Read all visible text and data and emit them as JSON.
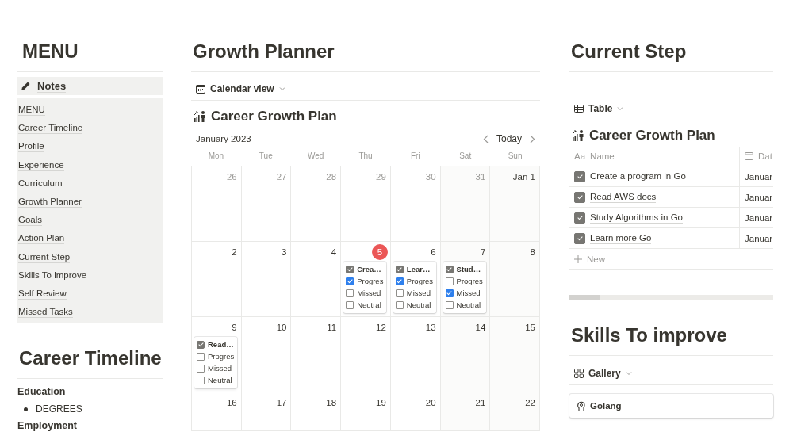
{
  "menu": {
    "title": "MENU",
    "callout": "Notes",
    "links": [
      "MENU",
      "Career Timeline",
      "Profile",
      "Experience",
      "Curriculum",
      "Growth Planner",
      "Goals",
      "Action Plan",
      "Current Step",
      "Skills To improve",
      "Self Review",
      "Missed Tasks"
    ]
  },
  "career_timeline": {
    "title": "Career Timeline",
    "sections": [
      {
        "heading": "Education",
        "bullets": [
          "DEGREES"
        ]
      },
      {
        "heading": "Employment"
      }
    ]
  },
  "growth_planner": {
    "title": "Growth Planner",
    "view": "Calendar view",
    "database_title": "Career Growth Plan",
    "month": "January 2023",
    "today_button": "Today",
    "weekdays": [
      "Mon",
      "Tue",
      "Wed",
      "Thu",
      "Fri",
      "Sat",
      "Sun"
    ],
    "weeks": [
      [
        {
          "label": "26",
          "current_month": false,
          "today": false
        },
        {
          "label": "27",
          "current_month": false,
          "today": false
        },
        {
          "label": "28",
          "current_month": false,
          "today": false
        },
        {
          "label": "29",
          "current_month": false,
          "today": false
        },
        {
          "label": "30",
          "current_month": false,
          "today": false
        },
        {
          "label": "31",
          "current_month": false,
          "today": false
        },
        {
          "label": "Jan 1",
          "current_month": true,
          "today": false
        }
      ],
      [
        {
          "label": "2",
          "current_month": true,
          "today": false
        },
        {
          "label": "3",
          "current_month": true,
          "today": false
        },
        {
          "label": "4",
          "current_month": true,
          "today": false
        },
        {
          "label": "5",
          "current_month": true,
          "today": true,
          "events": [
            {
              "title": "Crea…",
              "checked": true,
              "options": [
                {
                  "label": "Progres",
                  "checked": true
                },
                {
                  "label": "Missed",
                  "checked": false
                },
                {
                  "label": "Neutral",
                  "checked": false
                }
              ]
            }
          ]
        },
        {
          "label": "6",
          "current_month": true,
          "today": false,
          "events": [
            {
              "title": "Lear…",
              "checked": true,
              "options": [
                {
                  "label": "Progres",
                  "checked": true
                },
                {
                  "label": "Missed",
                  "checked": false
                },
                {
                  "label": "Neutral",
                  "checked": false
                }
              ]
            }
          ]
        },
        {
          "label": "7",
          "current_month": true,
          "today": false,
          "events": [
            {
              "title": "Stud…",
              "checked": true,
              "options": [
                {
                  "label": "Progres",
                  "checked": false
                },
                {
                  "label": "Missed",
                  "checked": true
                },
                {
                  "label": "Neutral",
                  "checked": false
                }
              ]
            }
          ]
        },
        {
          "label": "8",
          "current_month": true,
          "today": false
        }
      ],
      [
        {
          "label": "9",
          "current_month": true,
          "today": false,
          "events": [
            {
              "title": "Read…",
              "checked": true,
              "options": [
                {
                  "label": "Progres",
                  "checked": false
                },
                {
                  "label": "Missed",
                  "checked": false
                },
                {
                  "label": "Neutral",
                  "checked": false
                }
              ]
            }
          ]
        },
        {
          "label": "10",
          "current_month": true,
          "today": false
        },
        {
          "label": "11",
          "current_month": true,
          "today": false
        },
        {
          "label": "12",
          "current_month": true,
          "today": false
        },
        {
          "label": "13",
          "current_month": true,
          "today": false
        },
        {
          "label": "14",
          "current_month": true,
          "today": false
        },
        {
          "label": "15",
          "current_month": true,
          "today": false
        }
      ],
      [
        {
          "label": "16",
          "current_month": true,
          "today": false
        },
        {
          "label": "17",
          "current_month": true,
          "today": false
        },
        {
          "label": "18",
          "current_month": true,
          "today": false
        },
        {
          "label": "19",
          "current_month": true,
          "today": false
        },
        {
          "label": "20",
          "current_month": true,
          "today": false
        },
        {
          "label": "21",
          "current_month": true,
          "today": false
        },
        {
          "label": "22",
          "current_month": true,
          "today": false
        }
      ]
    ]
  },
  "current_step": {
    "title": "Current Step",
    "view": "Table",
    "database_title": "Career Growth Plan",
    "columns": [
      {
        "kind": "title",
        "type_label": "Aa",
        "label": "Name"
      },
      {
        "kind": "date",
        "label": "Dat"
      }
    ],
    "rows": [
      {
        "name": "Create a program in Go",
        "done": true,
        "date": "Januar"
      },
      {
        "name": "Read AWS docs",
        "done": true,
        "date": "Januar"
      },
      {
        "name": "Study Algorithms in Go",
        "done": true,
        "date": "Januar"
      },
      {
        "name": "Learn more Go",
        "done": true,
        "date": "Januar"
      }
    ],
    "new_label": "New"
  },
  "skills": {
    "title": "Skills To improve",
    "view": "Gallery",
    "cards": [
      {
        "title": "Golang"
      }
    ]
  }
}
